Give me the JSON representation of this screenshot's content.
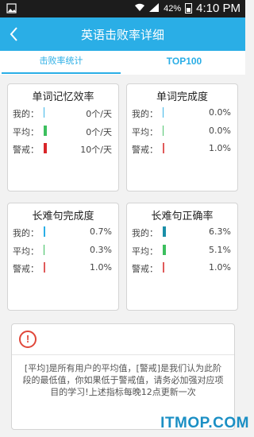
{
  "status_bar": {
    "left_icon": "image-icon",
    "battery": "42%",
    "time": "4:10 PM"
  },
  "header": {
    "title": "英语击败率详细",
    "back_icon": "chevron-left-icon"
  },
  "tabs": [
    {
      "label": "击败率统计",
      "active": true
    },
    {
      "label": "TOP100",
      "active": false
    }
  ],
  "cards": [
    {
      "title": "单词记忆效率",
      "rows": [
        {
          "label": "我的：",
          "value": "0个/天",
          "color": "#2aaee6",
          "level": 0
        },
        {
          "label": "平均：",
          "value": "0个/天",
          "color": "#3cbf5e",
          "level": 1
        },
        {
          "label": "警戒：",
          "value": "10个/天",
          "color": "#d9262a",
          "level": 1
        }
      ]
    },
    {
      "title": "单词完成度",
      "rows": [
        {
          "label": "我的：",
          "value": "0.0%",
          "color": "#2aaee6",
          "level": 0
        },
        {
          "label": "平均：",
          "value": "0.0%",
          "color": "#3cbf5e",
          "level": 0
        },
        {
          "label": "警戒：",
          "value": "1.0%",
          "color": "#e05a5a",
          "level": 0.3
        }
      ]
    },
    {
      "title": "长难句完成度",
      "rows": [
        {
          "label": "我的：",
          "value": "0.7%",
          "color": "#2aaee6",
          "level": 0.3
        },
        {
          "label": "平均：",
          "value": "0.3%",
          "color": "#3cbf5e",
          "level": 0.15
        },
        {
          "label": "警戒：",
          "value": "1.0%",
          "color": "#e05a5a",
          "level": 0.35
        }
      ]
    },
    {
      "title": "长难句正确率",
      "rows": [
        {
          "label": "我的：",
          "value": "6.3%",
          "color": "#1a8fa8",
          "level": 1
        },
        {
          "label": "平均：",
          "value": "5.1%",
          "color": "#3cbf5e",
          "level": 1
        },
        {
          "label": "警戒：",
          "value": "1.0%",
          "color": "#e05a5a",
          "level": 0.3
        }
      ]
    }
  ],
  "note": {
    "icon": "alert-circle-icon",
    "text": "[平均]是所有用户的平均值，[警戒]是我们认为此阶段的最低值，你如果低于警戒值，请务必加强对应项目的学习!上述指标每晚12点更新一次"
  },
  "watermark": "ITMOP.COM"
}
